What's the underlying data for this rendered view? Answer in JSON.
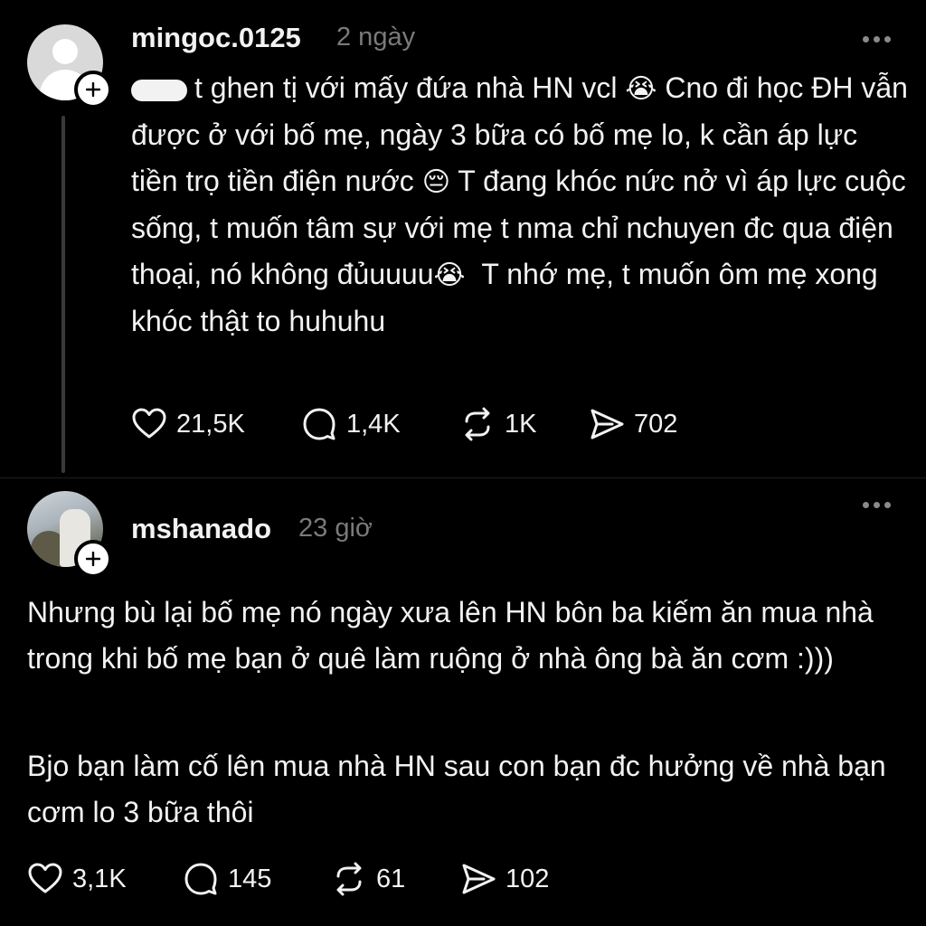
{
  "posts": [
    {
      "username": "mingoc.0125",
      "time": "2 ngày",
      "avatar_icon": "default-person-icon",
      "text_lead": "t ghen tị với mấy đứa nhà HN vcl",
      "emoji_1": "😭",
      "text_2": "Cno đi học ĐH vẫn được ở với bố mẹ, ngày 3 bữa có bố mẹ lo, k cần áp lực tiền trọ tiền điện nước",
      "emoji_2": "😔",
      "text_3": "T đang khóc nức nở vì áp lực cuộc sống, t muốn tâm sự với mẹ t nma chỉ nchuyen đc qua điện thoại, nó không đủuuuu",
      "emoji_3": "😭",
      "text_4": "T nhớ mẹ, t muốn ôm mẹ xong khóc thật to huhuhu",
      "likes": "21,5K",
      "comments": "1,4K",
      "reposts": "1K",
      "shares": "702"
    },
    {
      "username": "mshanado",
      "time": "23 giờ",
      "avatar_icon": "profile-photo",
      "paragraph_1": "Nhưng bù lại bố mẹ nó ngày xưa lên HN bôn ba kiếm ăn mua nhà trong khi bố mẹ bạn ở quê làm ruộng ở nhà ông bà ăn cơm :)))",
      "paragraph_2": "Bjo bạn làm cố lên mua nhà HN sau con bạn đc hưởng về nhà bạn cơm lo 3 bữa thôi",
      "likes": "3,1K",
      "comments": "145",
      "reposts": "61",
      "shares": "102"
    }
  ],
  "colors": {
    "background": "#000000",
    "text": "#f2f2f2",
    "muted": "#7a7a7a",
    "thread_line": "#3a3a3a"
  }
}
